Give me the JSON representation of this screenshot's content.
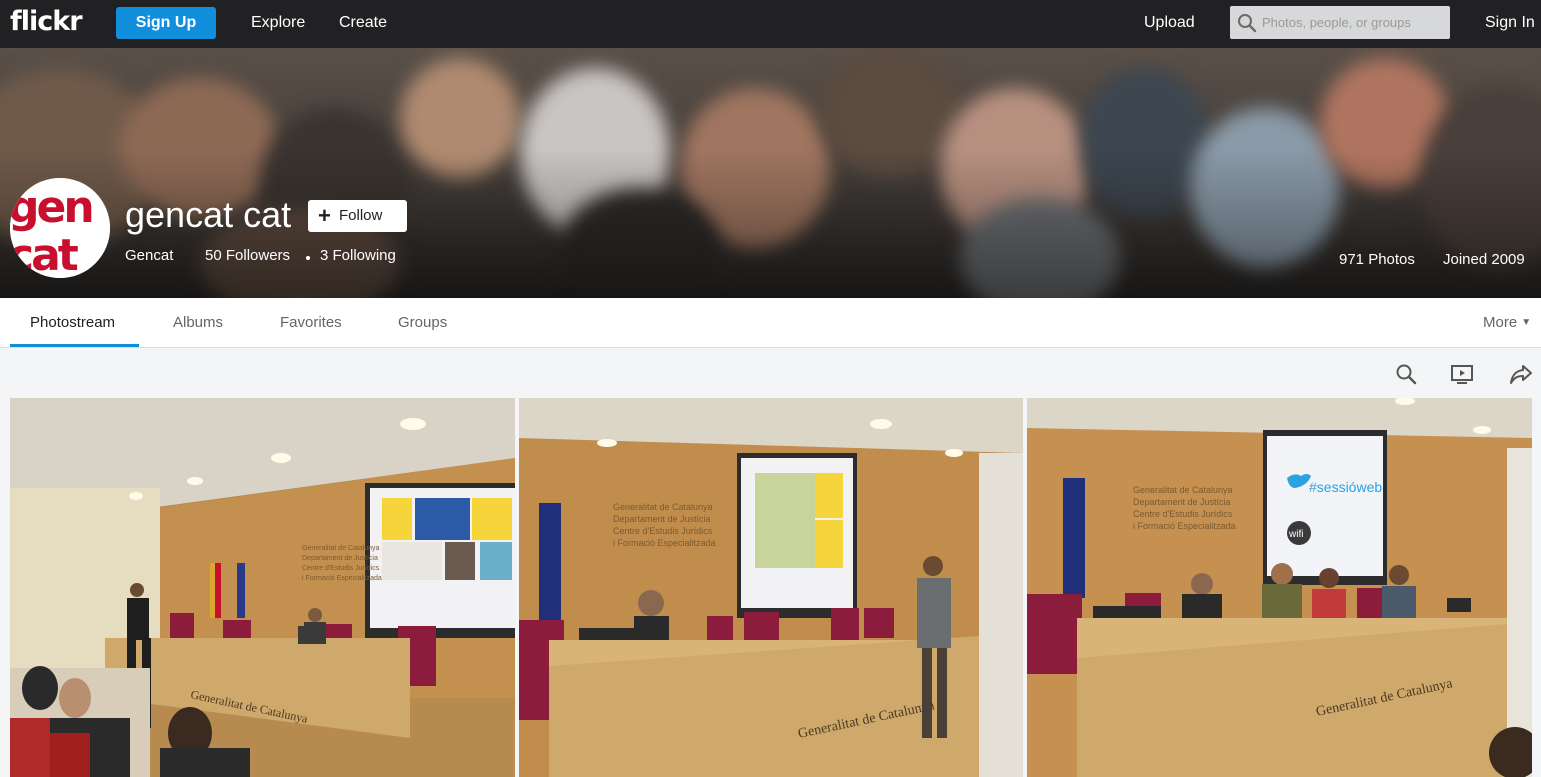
{
  "topnav": {
    "logo": "flickr",
    "signup_label": "Sign Up",
    "explore_label": "Explore",
    "create_label": "Create",
    "upload_label": "Upload",
    "search_placeholder": "Photos, people, or groups",
    "signin_label": "Sign In"
  },
  "profile": {
    "name": "gencat cat",
    "follow_label": "Follow",
    "realname": "Gencat",
    "followers": "50 Followers",
    "following": "3 Following",
    "photos": "971 Photos",
    "joined": "Joined 2009",
    "avatar_text": [
      "gen",
      "cat"
    ]
  },
  "subnav": {
    "tabs": [
      {
        "label": "Photostream",
        "active": true
      },
      {
        "label": "Albums",
        "active": false
      },
      {
        "label": "Favorites",
        "active": false
      },
      {
        "label": "Groups",
        "active": false
      }
    ],
    "more_label": "More"
  },
  "toolbar": {
    "icons": [
      "search-icon",
      "slideshow-icon",
      "share-icon"
    ]
  },
  "photos": {
    "photo1": {
      "wall_sign": [
        "Generalitat de Catalunya",
        "Departament de Justícia",
        "Centre d'Estudis Jurídics",
        "i Formació Especialitzada"
      ],
      "desk_text": "Generalitat de Catalunya"
    },
    "photo2": {
      "wall_sign": [
        "Generalitat de Catalunya",
        "Departament de Justícia",
        "Centre d'Estudis Jurídics",
        "i Formació Especialitzada"
      ],
      "desk_text": "Generalitat de Catalunya"
    },
    "photo3": {
      "wall_sign": [
        "Generalitat de Catalunya",
        "Departament de Justícia",
        "Centre d'Estudis Jurídics",
        "i Formació Especialitzada"
      ],
      "screen_hashtag": "#sessióweb",
      "screen_wifi": "wifi",
      "desk_text": "Generalitat de Catalunya"
    }
  },
  "colors": {
    "nav_bg": "#212124",
    "accent": "#128fdc",
    "avatar_red": "#c8102e"
  }
}
